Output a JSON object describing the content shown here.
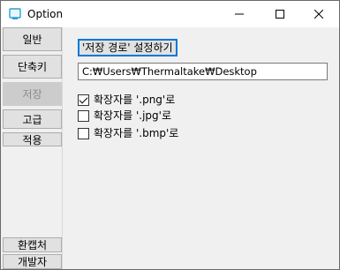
{
  "window": {
    "title": "Option",
    "icon": "app-window-icon",
    "controls": [
      "minimize-icon",
      "maximize-icon",
      "close-icon"
    ]
  },
  "sidebar": {
    "items": [
      {
        "label": "일반",
        "active": false
      },
      {
        "label": "단축키",
        "active": false
      },
      {
        "label": "저장",
        "active": true
      },
      {
        "label": "고급",
        "active": false
      },
      {
        "label": "적용",
        "active": false
      }
    ],
    "bottom_items": [
      {
        "label": "환캡처"
      },
      {
        "label": "개발자"
      }
    ]
  },
  "save": {
    "set_path_button": "'저장 경로' 설정하기",
    "path_value": "C:₩Users₩Thermaltake₩Desktop",
    "options": [
      {
        "label": "확장자를 '.png'로",
        "checked": true
      },
      {
        "label": "확장자를 '.jpg'로",
        "checked": false
      },
      {
        "label": "확장자를 '.bmp'로",
        "checked": false
      }
    ]
  },
  "colors": {
    "accent": "#0078d7",
    "title_bar": "#ffffff",
    "panel": "#f0f0f0",
    "button": "#e1e1e1",
    "active_button": "#cccccc"
  }
}
